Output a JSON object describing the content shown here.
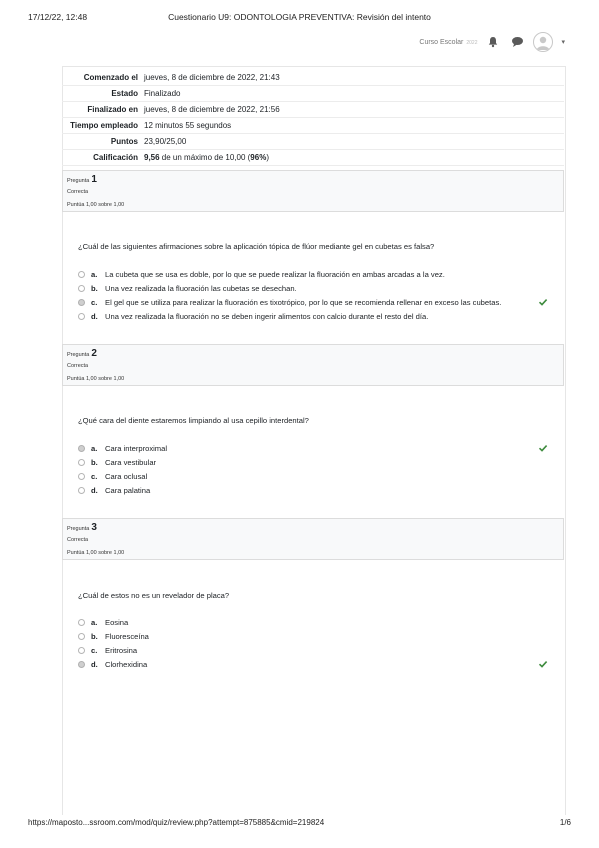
{
  "print": {
    "date": "17/12/22, 12:48",
    "title": "Cuestionario U9: ODONTOLOGIA PREVENTIVA: Revisión del intento",
    "url": "https://maposto...ssroom.com/mod/quiz/review.php?attempt=875885&cmid=219824",
    "page": "1/6"
  },
  "topnav": {
    "course": "Curso Escolar",
    "course_year": "2022"
  },
  "summary": [
    {
      "label": "Comenzado el",
      "value": "jueves, 8 de diciembre de 2022, 21:43"
    },
    {
      "label": "Estado",
      "value": "Finalizado"
    },
    {
      "label": "Finalizado en",
      "value": "jueves, 8 de diciembre de 2022, 21:56"
    },
    {
      "label": "Tiempo empleado",
      "value": "12 minutos 55 segundos"
    },
    {
      "label": "Puntos",
      "value": "23,90/25,00"
    },
    {
      "label": "Calificación",
      "value_bold": "9,56",
      "value_mid": " de un máximo de 10,00 (",
      "value_pct": "96%",
      "value_end": ")"
    }
  ],
  "questions": [
    {
      "label": "Pregunta",
      "number": "1",
      "state": "Correcta",
      "grade": "Puntúa 1,00 sobre 1,00",
      "text": "¿Cuál de las siguientes afirmaciones sobre la aplicación tópica de flúor mediante gel en cubetas es falsa?",
      "answers": [
        {
          "letter": "a.",
          "text": "La cubeta que se usa es doble, por lo que se puede realizar la fluoración en ambas arcadas a la vez.",
          "selected": false,
          "correct": false
        },
        {
          "letter": "b.",
          "text": "Una vez realizada la fluoración las cubetas se desechan.",
          "selected": false,
          "correct": false
        },
        {
          "letter": "c.",
          "text": "El gel que se utiliza para realizar la fluoración es tixotrópico, por lo que se recomienda rellenar en exceso las cubetas.",
          "selected": true,
          "correct": true
        },
        {
          "letter": "d.",
          "text": "Una vez realizada la fluoración no se deben ingerir alimentos con calcio durante el resto del día.",
          "selected": false,
          "correct": false
        }
      ]
    },
    {
      "label": "Pregunta",
      "number": "2",
      "state": "Correcta",
      "grade": "Puntúa 1,00 sobre 1,00",
      "text": "¿Qué cara del diente estaremos limpiando al usa cepillo interdental?",
      "answers": [
        {
          "letter": "a.",
          "text": "Cara interproximal",
          "selected": true,
          "correct": true
        },
        {
          "letter": "b.",
          "text": "Cara vestibular",
          "selected": false,
          "correct": false
        },
        {
          "letter": "c.",
          "text": "Cara oclusal",
          "selected": false,
          "correct": false
        },
        {
          "letter": "d.",
          "text": "Cara palatina",
          "selected": false,
          "correct": false
        }
      ]
    },
    {
      "label": "Pregunta",
      "number": "3",
      "state": "Correcta",
      "grade": "Puntúa 1,00 sobre 1,00",
      "text": "¿Cuál de estos no es un revelador de placa?",
      "answers": [
        {
          "letter": "a.",
          "text": "Eosina",
          "selected": false,
          "correct": false
        },
        {
          "letter": "b.",
          "text": "Fluoresceína",
          "selected": false,
          "correct": false
        },
        {
          "letter": "c.",
          "text": "Eritrosina",
          "selected": false,
          "correct": false
        },
        {
          "letter": "d.",
          "text": "Clorhexidina",
          "selected": true,
          "correct": true
        }
      ]
    }
  ],
  "colors": {
    "check": "#3e8b3e",
    "text": "#1d2125",
    "border": "#dcdcdc"
  }
}
